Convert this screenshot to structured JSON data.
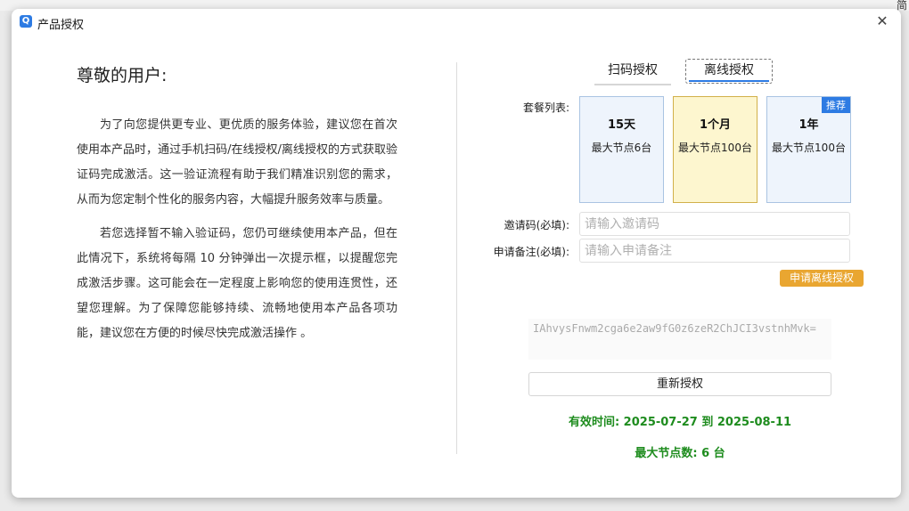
{
  "window": {
    "title": "产品授权",
    "app_icon": "Q",
    "close": "✕"
  },
  "left": {
    "greeting": "尊敬的用户:",
    "paragraphs": [
      "为了向您提供更专业、更优质的服务体验，建议您在首次使用本产品时，通过手机扫码/在线授权/离线授权的方式获取验证码完成激活。这一验证流程有助于我们精准识别您的需求，从而为您定制个性化的服务内容，大幅提升服务效率与质量。",
      "若您选择暂不输入验证码，您仍可继续使用本产品，但在此情况下，系统将每隔 10 分钟弹出一次提示框，以提醒您完成激活步骤。这可能会在一定程度上影响您的使用连贯性，还望您理解。为了保障您能够持续、流畅地使用本产品各项功能，建议您在方便的时候尽快完成激活操作 。"
    ]
  },
  "tabs": [
    {
      "label": "扫码授权",
      "active": false
    },
    {
      "label": "离线授权",
      "active": true
    }
  ],
  "packages": {
    "label": "套餐列表:",
    "items": [
      {
        "name": "15天",
        "desc": "最大节点6台",
        "selected": false,
        "badge": ""
      },
      {
        "name": "1个月",
        "desc": "最大节点100台",
        "selected": true,
        "badge": ""
      },
      {
        "name": "1年",
        "desc": "最大节点100台",
        "selected": false,
        "badge": "推荐"
      }
    ]
  },
  "form": {
    "invite_label": "邀请码(必填):",
    "invite_placeholder": "请输入邀请码",
    "invite_value": "",
    "note_label": "申请备注(必填):",
    "note_placeholder": "请输入申请备注",
    "note_value": "",
    "apply_button": "申请离线授权"
  },
  "code": "IAhvysFnwm2cga6e2aw9fG0z6zeR2ChJCI3vstnhMvk=",
  "reauth_button": "重新授权",
  "validity": "有效时间: 2025-07-27 到 2025-08-11",
  "max_nodes": "最大节点数: 6 台",
  "colors": {
    "accent": "#2d7be3",
    "apply_button": "#e9a631",
    "success_text": "#1e8c1e",
    "selected_package_bg": "#fdf6cf",
    "package_bg": "#eef4fc"
  },
  "background_fragment": "简"
}
